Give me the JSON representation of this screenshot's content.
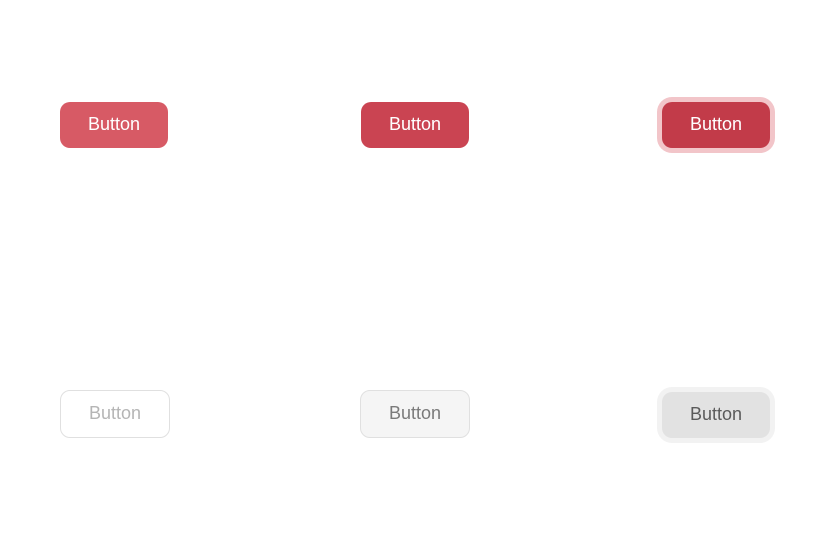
{
  "buttons": {
    "primary_default": "Button",
    "primary_hover": "Button",
    "primary_focus": "Button",
    "secondary_default": "Button",
    "secondary_hover": "Button",
    "secondary_focus": "Button"
  }
}
